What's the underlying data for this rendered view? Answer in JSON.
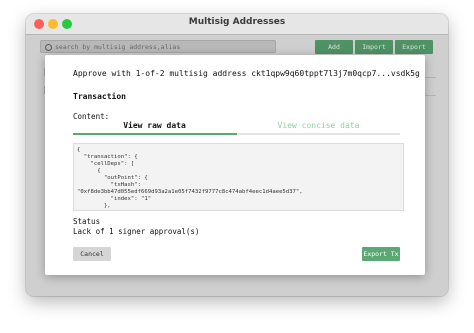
{
  "window": {
    "title": "Multisig Addresses"
  },
  "toolbar": {
    "search_placeholder": "search by multisig address,alias",
    "add_label": "Add",
    "import_label": "Import",
    "export_label": "Export"
  },
  "dialog": {
    "approve_text": "Approve with 1-of-2 multisig address ckt1qpw9q60tppt7l3j7m0qcp7...vsdk5g",
    "section_title": "Transaction",
    "content_label": "Content:",
    "tabs": [
      {
        "label": "View raw data",
        "active": true
      },
      {
        "label": "View concise data",
        "active": false
      }
    ],
    "code_text": "{\n  \"transaction\": {\n    \"cellDeps\": [\n      {\n        \"outPoint\": {\n          \"txHash\":\n\"0xf8de3bb47d055edf669d93a2a1e05f7432f9777c8c474abf4eec1d4aee5d37\",\n          \"index\": \"1\"\n        },\n        \"depType\": \"depGroup\"",
    "status_label": "Status",
    "status_value": "Lack of 1 signer approval(s)",
    "cancel_label": "Cancel",
    "export_tx_label": "Export Tx"
  },
  "colors": {
    "accent": "#5aa874",
    "accent_light": "#8fcf9f",
    "close": "#fe5f57",
    "minimize": "#febc2e",
    "maximize": "#28c840"
  }
}
